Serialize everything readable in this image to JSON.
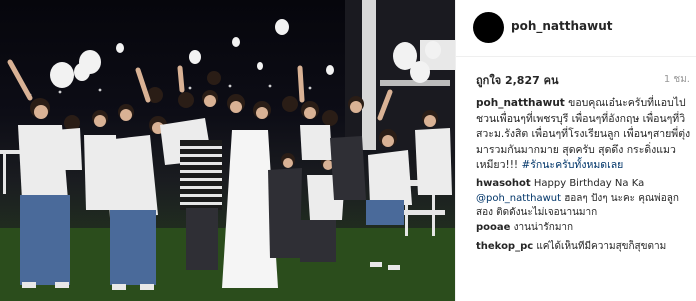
{
  "post": {
    "username": "poh_natthawut",
    "likes": "ถูกใจ 2,827 คน",
    "time": "1 ชม.",
    "caption_user": "poh_natthawut",
    "caption_text": " ขอบคุณเอ๋นะครับที่แอบไปชวนเพื่อนๆที่เพชรบุรี เพื่อนๆที่อังกฤษ เพื่อนๆที่วิสวะม.รังสิต เพื่อนๆที่โรงเรียนลูก เพื่อนๆสายพี่ตุ่ง มารวมกันมากมาย สุดครับ สุดดึง กระดิ่งแมวเหมียว!!! ",
    "caption_tag": "#รักนะครับทั้งหมดเลย"
  },
  "comments": [
    {
      "user": "hwasohot",
      "text": " Happy Birthday Na Ka ",
      "mention": "@poh_natthawut",
      "text2": " ฮอลๆ ปังๆ นะคะ คุณพ่อลูกสอง ติดดังนะไม่เจอนานมาก"
    },
    {
      "user": "pooae",
      "text": " งานน่ารักมาก"
    },
    {
      "user": "thekop_pc",
      "text": " แค่ได้เห็นที่มีความสุขก็สุขตาม"
    }
  ],
  "colors": {
    "link": "#003569",
    "muted": "#999999",
    "border": "#efefef"
  }
}
